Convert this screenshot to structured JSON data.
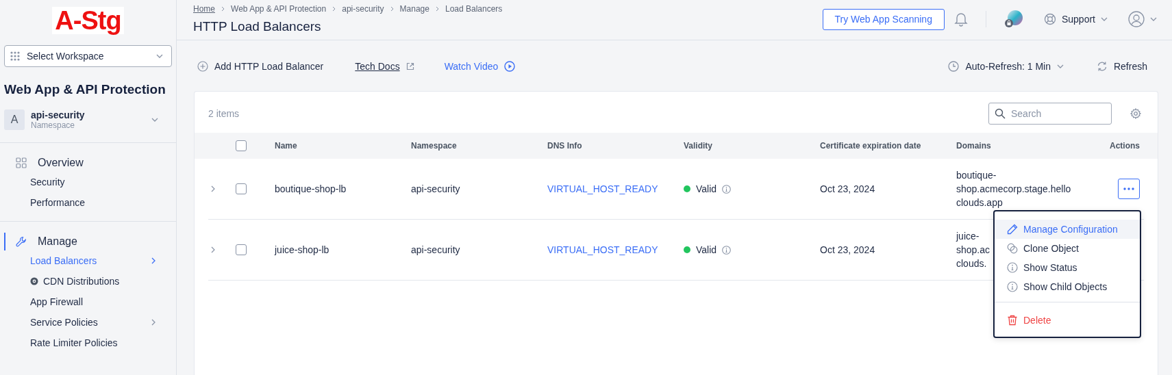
{
  "logo": "A-Stg",
  "workspace": {
    "label": "Select Workspace"
  },
  "sidebar": {
    "title": "Web App & API Protection",
    "namespace": {
      "avatar": "A",
      "name": "api-security",
      "caption": "Namespace"
    },
    "sections": [
      {
        "label": "Overview",
        "selected": false,
        "items": [
          {
            "label": "Security",
            "selected": false,
            "kind": "plain",
            "submenu": false
          },
          {
            "label": "Performance",
            "selected": false,
            "kind": "plain",
            "submenu": false
          }
        ]
      },
      {
        "label": "Manage",
        "selected": true,
        "items": [
          {
            "label": "Load Balancers",
            "selected": true,
            "kind": "plain",
            "submenu": true
          },
          {
            "label": "CDN Distributions",
            "selected": false,
            "kind": "icon",
            "submenu": false
          },
          {
            "label": "App Firewall",
            "selected": false,
            "kind": "plain",
            "submenu": false
          },
          {
            "label": "Service Policies",
            "selected": false,
            "kind": "plain",
            "submenu": true
          },
          {
            "label": "Rate Limiter Policies",
            "selected": false,
            "kind": "plain",
            "submenu": false
          }
        ]
      }
    ]
  },
  "breadcrumbs": [
    {
      "label": "Home",
      "link": true
    },
    {
      "label": "Web App & API Protection",
      "link": false
    },
    {
      "label": "api-security",
      "link": false
    },
    {
      "label": "Manage",
      "link": false
    },
    {
      "label": "Load Balancers",
      "link": false
    }
  ],
  "title": "HTTP Load Balancers",
  "header": {
    "cta": "Try Web App Scanning",
    "support": "Support"
  },
  "toolbar": {
    "add": "Add HTTP Load Balancer",
    "docs": "Tech Docs",
    "video": "Watch Video",
    "auto_refresh": "Auto-Refresh: 1 Min",
    "refresh": "Refresh"
  },
  "table": {
    "count": "2 items",
    "search": {
      "placeholder": "Search"
    },
    "all_checked": false,
    "columns": [
      "Name",
      "Namespace",
      "DNS Info",
      "Validity",
      "Certificate expiration date",
      "Domains",
      "Actions"
    ],
    "rows": [
      {
        "expanded": false,
        "checked": false,
        "name": "boutique-shop-lb",
        "namespace": "api-security",
        "dns": "VIRTUAL_HOST_READY",
        "validity": "Valid",
        "color": "#22c55e",
        "cert": "Oct 23, 2024",
        "domain_lines": [
          "boutique-",
          "shop.acmecorp.stage.hello",
          "clouds.app"
        ],
        "menu_open": true
      },
      {
        "expanded": false,
        "checked": false,
        "name": "juice-shop-lb",
        "namespace": "api-security",
        "dns": "VIRTUAL_HOST_READY",
        "validity": "Valid",
        "color": "#22c55e",
        "cert": "Oct 23, 2024",
        "domain_lines": [
          "juice-",
          "shop.ac",
          "clouds."
        ],
        "menu_open": false
      }
    ]
  },
  "menu": [
    {
      "label": "Manage Configuration",
      "kind": "edit",
      "selected": true
    },
    {
      "label": "Clone Object",
      "kind": "clone",
      "selected": false
    },
    {
      "label": "Show Status",
      "kind": "info",
      "selected": false
    },
    {
      "label": "Show Child Objects",
      "kind": "info",
      "selected": false
    },
    {
      "label": "Delete",
      "kind": "delete",
      "selected": false
    }
  ]
}
